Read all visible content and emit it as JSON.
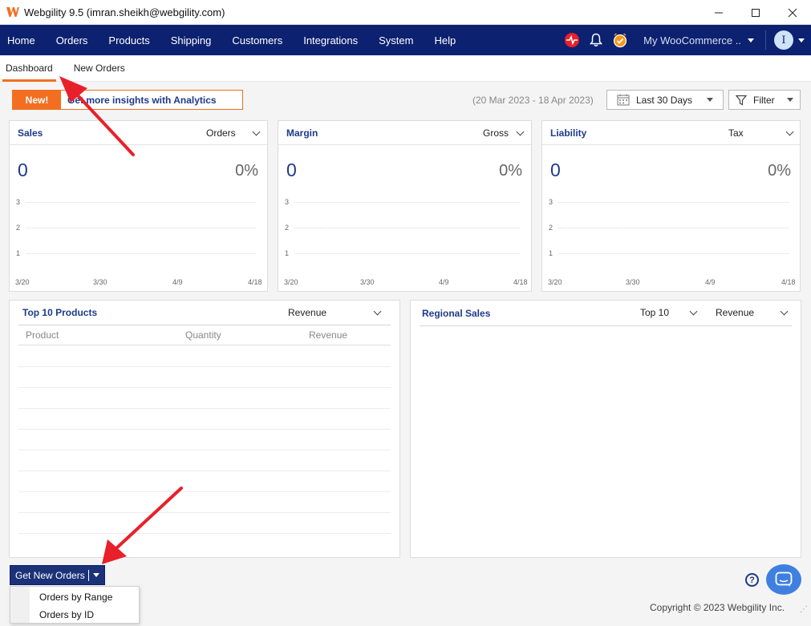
{
  "window": {
    "title": "Webgility 9.5 (imran.sheikh@webgility.com)"
  },
  "nav": {
    "items": [
      "Home",
      "Orders",
      "Products",
      "Shipping",
      "Customers",
      "Integrations",
      "System",
      "Help"
    ],
    "store": "My WooCommerce ..",
    "avatar_initial": "I"
  },
  "tabs": [
    "Dashboard",
    "New Orders"
  ],
  "promo": {
    "badge": "New!",
    "text": "Get more insights with Analytics"
  },
  "date_range": "(20 Mar 2023 - 18 Apr 2023)",
  "period_select": "Last 30 Days",
  "filter_label": "Filter",
  "cards": [
    {
      "title": "Sales",
      "selector": "Orders",
      "value": "0",
      "percent": "0%"
    },
    {
      "title": "Margin",
      "selector": "Gross",
      "value": "0",
      "percent": "0%"
    },
    {
      "title": "Liability",
      "selector": "Tax",
      "value": "0",
      "percent": "0%"
    }
  ],
  "chart_axis": {
    "y_ticks": [
      "3",
      "2",
      "1"
    ],
    "x_ticks": [
      "3/20",
      "3/30",
      "4/9",
      "4/18"
    ]
  },
  "top_products": {
    "title": "Top 10 Products",
    "selector": "Revenue",
    "columns": [
      "Product",
      "Quantity",
      "Revenue"
    ]
  },
  "regional": {
    "title": "Regional Sales",
    "count_select": "Top 10",
    "metric_select": "Revenue"
  },
  "get_orders": {
    "label": "Get New Orders",
    "menu": [
      "Orders by Range",
      "Orders by ID"
    ]
  },
  "help_label": "?",
  "footer": {
    "copyright": "Copyright © 2023 Webgility Inc."
  },
  "colors": {
    "nav": "#0c2170",
    "accent": "#f26f21",
    "title": "#1d3a8a",
    "chat": "#3f7fe0",
    "annotation": "#e8202a"
  }
}
